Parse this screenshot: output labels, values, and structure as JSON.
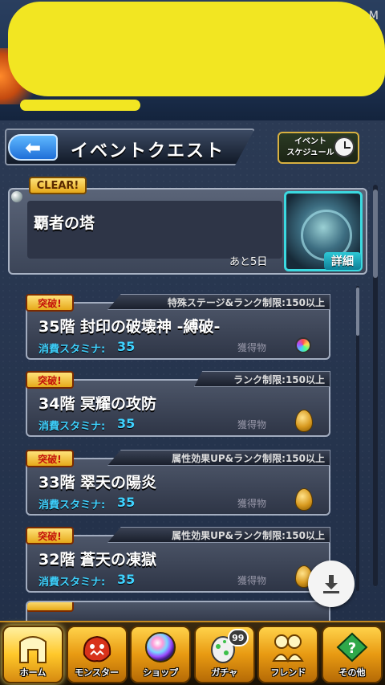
{
  "status": {
    "indicator": "M"
  },
  "header": {
    "title": "イベントクエスト",
    "schedule_label_line1": "イベント",
    "schedule_label_line2": "スケジュール"
  },
  "event": {
    "clear_badge": "CLEAR!",
    "title": "覇者の塔",
    "remaining": "あと5日",
    "detail_label": "詳細"
  },
  "quests": [
    {
      "badge": "突破!",
      "restriction": "特殊ステージ&ランク制限:150以上",
      "name": "35階 封印の破壊神 -縛破-",
      "stamina_label": "消費スタミナ:",
      "stamina_value": "35",
      "reward_label": "獲得物",
      "reward_icon": "rainbow-orb"
    },
    {
      "badge": "突破!",
      "restriction": "ランク制限:150以上",
      "name": "34階 冥耀の攻防",
      "stamina_label": "消費スタミナ:",
      "stamina_value": "35",
      "reward_label": "獲得物",
      "reward_icon": "golden-egg"
    },
    {
      "badge": "突破!",
      "restriction": "属性効果UP&ランク制限:150以上",
      "name": "33階 翠天の陽炎",
      "stamina_label": "消費スタミナ:",
      "stamina_value": "35",
      "reward_label": "獲得物",
      "reward_icon": "golden-egg"
    },
    {
      "badge": "突破!",
      "restriction": "属性効果UP&ランク制限:150以上",
      "name": "32階 蒼天の凍獄",
      "stamina_label": "消費スタミナ:",
      "stamina_value": "35",
      "reward_label": "獲得物",
      "reward_icon": "golden-egg"
    }
  ],
  "nav": {
    "home": "ホーム",
    "monster": "モンスター",
    "shop": "ショップ",
    "gacha": "ガチャ",
    "gacha_count": "99",
    "friend": "フレンド",
    "other": "その他"
  },
  "colors": {
    "accent_cyan": "#3fd2ff",
    "badge_gold": "#e6a91a",
    "redaction": "#f2e622"
  }
}
